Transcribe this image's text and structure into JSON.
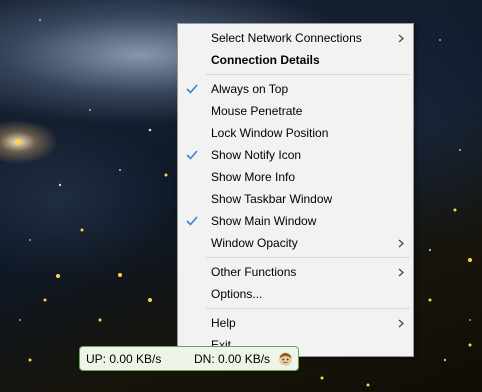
{
  "menu": {
    "items": [
      {
        "label": "Select Network Connections",
        "checked": false,
        "submenu": true,
        "bold": false
      },
      {
        "label": "Connection Details",
        "checked": false,
        "submenu": false,
        "bold": true
      },
      {
        "label": "Always on Top",
        "checked": true,
        "submenu": false,
        "bold": false
      },
      {
        "label": "Mouse Penetrate",
        "checked": false,
        "submenu": false,
        "bold": false
      },
      {
        "label": "Lock Window Position",
        "checked": false,
        "submenu": false,
        "bold": false
      },
      {
        "label": "Show Notify Icon",
        "checked": true,
        "submenu": false,
        "bold": false
      },
      {
        "label": "Show More Info",
        "checked": false,
        "submenu": false,
        "bold": false
      },
      {
        "label": "Show Taskbar Window",
        "checked": false,
        "submenu": false,
        "bold": false
      },
      {
        "label": "Show Main Window",
        "checked": true,
        "submenu": false,
        "bold": false
      },
      {
        "label": "Window Opacity",
        "checked": false,
        "submenu": true,
        "bold": false
      },
      {
        "label": "Other Functions",
        "checked": false,
        "submenu": true,
        "bold": false
      },
      {
        "label": "Options...",
        "checked": false,
        "submenu": false,
        "bold": false
      },
      {
        "label": "Help",
        "checked": false,
        "submenu": true,
        "bold": false
      },
      {
        "label": "Exit",
        "checked": false,
        "submenu": false,
        "bold": false
      }
    ]
  },
  "status": {
    "up": "UP: 0.00 KB/s",
    "dn": "DN: 0.00 KB/s"
  },
  "colors": {
    "check": "#3c7fd6",
    "status_border": "#6aa15a"
  }
}
